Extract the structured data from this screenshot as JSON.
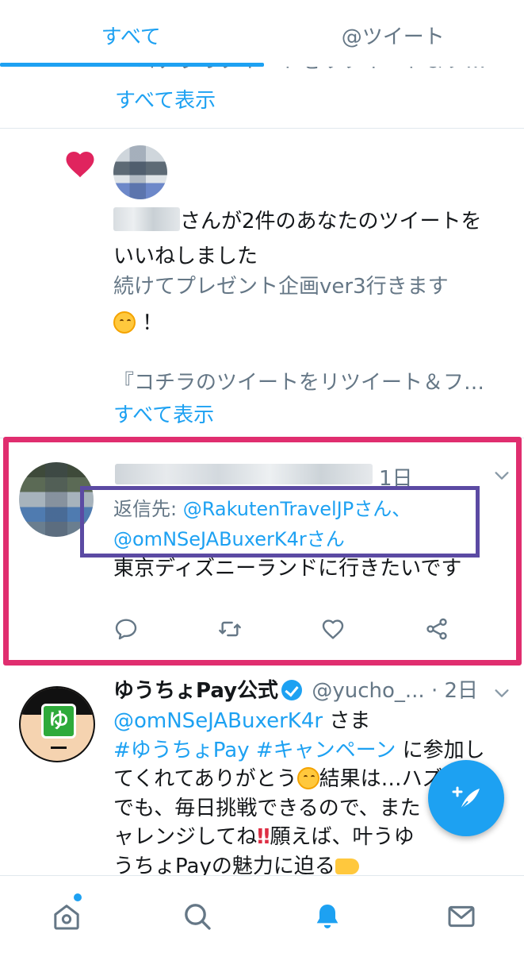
{
  "tabs": [
    {
      "label": "すべて",
      "active": true
    },
    {
      "label": "@ツイート",
      "active": false
    }
  ],
  "partial_item": {
    "clipped_text": "『コチラのツイートをリツイート＆フ…",
    "show_all": "すべて表示"
  },
  "like_notification": {
    "icon": "heart-icon",
    "text_suffix": "さんが2件のあなたのツイートを",
    "text_line2": "いいねしました",
    "quote_line1": "続けてプレゼント企画ver3行きます",
    "quote_line2": "！",
    "quote_line3": "『コチラのツイートをリツイート＆フ…",
    "show_all": "すべて表示"
  },
  "reply_tweet": {
    "time": "1日",
    "reply_prefix": "返信先: ",
    "reply_handle1": "@RakutenTravelJPさん、",
    "reply_handle2": "@omNSeJABuxerK4rさん",
    "body": "東京ディズニーランドに行きたいです",
    "actions": [
      "reply-icon",
      "retweet-icon",
      "like-icon",
      "share-icon"
    ]
  },
  "yucho_tweet": {
    "name": "ゆうちょPay公式",
    "handle": "@yucho_...",
    "time": "· 2日",
    "avatar_letter": "ゆ",
    "mention": "@omNSeJABuxerK4r",
    "mention_suffix": " さま",
    "hashtags": "#ゆうちょPay #キャンペーン",
    "line2_suffix": " に参加し",
    "line3": "てくれてありがとう",
    "line3_suffix": "結果は…ハズレ",
    "line4": "でも、毎日挑戦できるので、また",
    "line5_a": "ャレンジしてね",
    "line5_bang": "‼",
    "line5_b": "願えば、叶う",
    "line5_c": "ゆ",
    "line6": "うちょPayの魅力に迫る"
  },
  "fab": {
    "icon": "compose-tweet-icon"
  },
  "bottom_nav": [
    {
      "name": "home-icon",
      "active": false,
      "badge": true
    },
    {
      "name": "search-icon",
      "active": false
    },
    {
      "name": "notifications-icon",
      "active": true
    },
    {
      "name": "messages-icon",
      "active": false
    }
  ],
  "colors": {
    "accent": "#1da1f2",
    "highlight_frame": "#e02e6f",
    "reply_box": "#5b4aa3",
    "heart": "#e0245e"
  }
}
